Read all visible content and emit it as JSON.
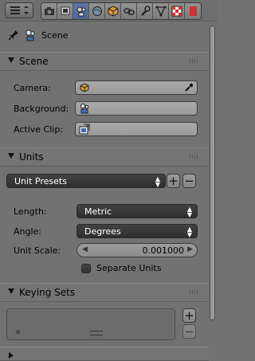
{
  "context": {
    "label": "Scene"
  },
  "scene_panel": {
    "title": "Scene",
    "fields": [
      {
        "label": "Camera:",
        "value": ""
      },
      {
        "label": "Background:",
        "value": ""
      },
      {
        "label": "Active Clip:",
        "value": ""
      }
    ]
  },
  "units_panel": {
    "title": "Units",
    "presets": "Unit Presets",
    "length_label": "Length:",
    "length_value": "Metric",
    "angle_label": "Angle:",
    "angle_value": "Degrees",
    "scale_label": "Unit Scale:",
    "scale_value": "0.001000",
    "separate_label": "Separate Units"
  },
  "keying_panel": {
    "title": "Keying Sets"
  },
  "colors": {
    "active_tab": "#5e78a8",
    "camera_icon": "#e39a3c"
  }
}
